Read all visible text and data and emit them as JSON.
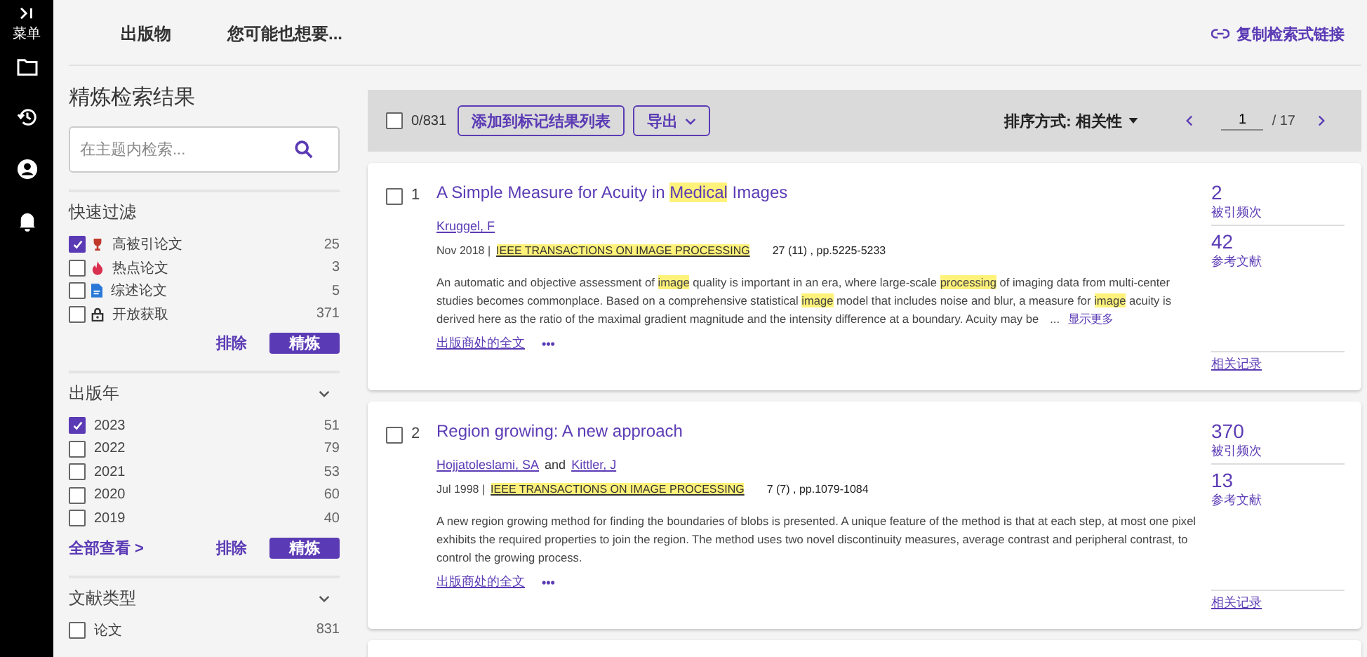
{
  "nav_rail": {
    "menu_label": "菜单",
    "items": [
      {
        "kind": "folder"
      },
      {
        "kind": "history"
      },
      {
        "kind": "account"
      },
      {
        "kind": "bell"
      }
    ]
  },
  "top_tabs": [
    "出版物",
    "您可能也想要..."
  ],
  "copy_link": "复制检索式链接",
  "refine": {
    "title": "精炼检索结果",
    "search_placeholder": "在主题内检索...",
    "sections": [
      {
        "title": "快速过滤",
        "collapsible": false,
        "items": [
          {
            "label": "高被引论文",
            "count": "25",
            "checked": true,
            "kind": "trophy"
          },
          {
            "label": "热点论文",
            "count": "3",
            "checked": false,
            "kind": "flame"
          },
          {
            "label": "综述论文",
            "count": "5",
            "checked": false,
            "kind": "document"
          },
          {
            "label": "开放获取",
            "count": "371",
            "checked": false,
            "kind": "lock"
          }
        ],
        "exclude": "排除",
        "apply": "精炼"
      },
      {
        "title": "出版年",
        "collapsible": true,
        "items": [
          {
            "label": "2023",
            "count": "51",
            "checked": true
          },
          {
            "label": "2022",
            "count": "79",
            "checked": false
          },
          {
            "label": "2021",
            "count": "53",
            "checked": false
          },
          {
            "label": "2020",
            "count": "60",
            "checked": false
          },
          {
            "label": "2019",
            "count": "40",
            "checked": false
          }
        ],
        "view_all": "全部查看 >",
        "exclude": "排除",
        "apply": "精炼"
      },
      {
        "title": "文献类型",
        "collapsible": true,
        "items": [
          {
            "label": "论文",
            "count": "831",
            "checked": false
          }
        ]
      }
    ]
  },
  "toolbar": {
    "all_selected": false,
    "selected_count": "0/831",
    "add_to_list": "添加到标记结果列表",
    "export": "导出",
    "sort": "排序方式: 相关性",
    "page": "1",
    "total_pages": "/ 17"
  },
  "author_joiner": "and",
  "results": [
    {
      "index": "1",
      "checked": false,
      "title": [
        {
          "text": "A Simple Measure for Acuity in ",
          "highlight": false
        },
        {
          "text": "Medical",
          "highlight": true
        },
        {
          "text": " Images",
          "highlight": false
        }
      ],
      "authors": [
        "Kruggel, F"
      ],
      "date": "Nov 2018 |",
      "journal": "IEEE TRANSACTIONS ON IMAGE PROCESSING",
      "volume": "27 (11) , pp.5225-5233",
      "abstract": [
        {
          "text": "An automatic and objective assessment of ",
          "highlight": false
        },
        {
          "text": "image",
          "highlight": true
        },
        {
          "text": " quality is important in an era, where large-scale ",
          "highlight": false
        },
        {
          "text": "processing",
          "highlight": true
        },
        {
          "text": " of imaging data from multi-center studies becomes commonplace. Based on a comprehensive statistical ",
          "highlight": false
        },
        {
          "text": "image",
          "highlight": true
        },
        {
          "text": " model that includes noise and blur, a measure for ",
          "highlight": false
        },
        {
          "text": "image",
          "highlight": true
        },
        {
          "text": " acuity is derived here as the ratio of the maximal gradient magnitude and the intensity difference at a boundary. Acuity may be",
          "highlight": false
        }
      ],
      "ellipsis": "...",
      "show_more": "显示更多",
      "full_text": "出版商处的全文",
      "more": "•••",
      "citations": "2",
      "citations_label": "被引频次",
      "references": "42",
      "references_label": "参考文献",
      "related": "相关记录"
    },
    {
      "index": "2",
      "checked": false,
      "title": [
        {
          "text": "Region growing: A new approach",
          "highlight": false
        }
      ],
      "authors": [
        "Hojjatoleslami, SA",
        "Kittler, J"
      ],
      "date": "Jul 1998 |",
      "journal": "IEEE TRANSACTIONS ON IMAGE PROCESSING",
      "volume": "7 (7) , pp.1079-1084",
      "abstract": [
        {
          "text": "A new region growing method for finding the boundaries of blobs is presented. A unique feature of the method is that at each step, at most one pixel exhibits the required properties to join the region. The method uses two novel discontinuity measures, average contrast and peripheral contrast, to control the growing process.",
          "highlight": false
        }
      ],
      "full_text": "出版商处的全文",
      "more": "•••",
      "citations": "370",
      "citations_label": "被引频次",
      "references": "13",
      "references_label": "参考文献",
      "related": "相关记录"
    }
  ]
}
